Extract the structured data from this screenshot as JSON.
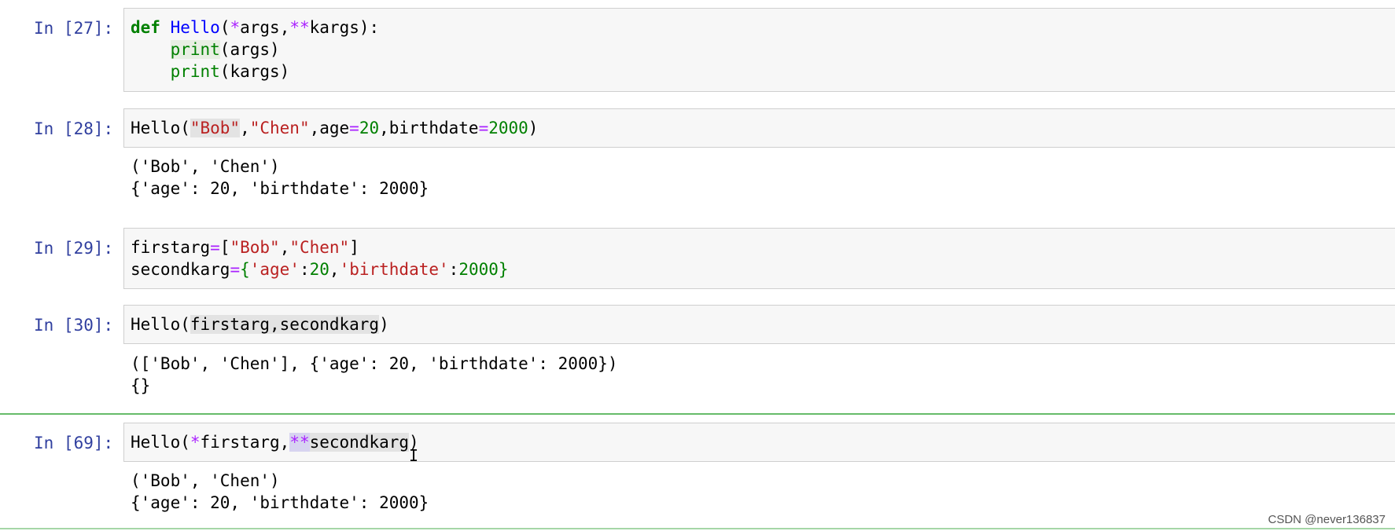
{
  "cells": [
    {
      "prompt": "In [27]:",
      "input_lines": [
        [
          [
            "def",
            "kw"
          ],
          [
            " ",
            ""
          ],
          [
            "Hello",
            "fn"
          ],
          [
            "(",
            ""
          ],
          [
            "*",
            "op"
          ],
          [
            "args,",
            ""
          ],
          [
            "**",
            "op"
          ],
          [
            "kargs):",
            ""
          ]
        ],
        [
          [
            "    ",
            ""
          ],
          [
            "print",
            "num hlg"
          ],
          [
            "(args)",
            ""
          ]
        ],
        [
          [
            "    ",
            ""
          ],
          [
            "print",
            "num"
          ],
          [
            "(kargs)",
            ""
          ]
        ]
      ],
      "output_lines": []
    },
    {
      "prompt": "In [28]:",
      "input_lines": [
        [
          [
            "Hello(",
            ""
          ],
          [
            "\"Bob\"",
            "str hl"
          ],
          [
            ",",
            ""
          ],
          [
            "\"Chen\"",
            "str"
          ],
          [
            ",age",
            ""
          ],
          [
            "=",
            "op"
          ],
          [
            "20",
            "num"
          ],
          [
            ",birthdate",
            ""
          ],
          [
            "=",
            "op"
          ],
          [
            "2000",
            "num"
          ],
          [
            ")",
            ""
          ]
        ]
      ],
      "output_lines": [
        "('Bob', 'Chen')",
        "{'age': 20, 'birthdate': 2000}"
      ]
    },
    {
      "prompt": "In [29]:",
      "input_lines": [
        [
          [
            "firstarg",
            ""
          ],
          [
            "=",
            "op"
          ],
          [
            "[",
            ""
          ],
          [
            "\"Bob\"",
            "str"
          ],
          [
            ",",
            ""
          ],
          [
            "\"Chen\"",
            "str"
          ],
          [
            "]",
            ""
          ]
        ],
        [
          [
            "secondkarg",
            ""
          ],
          [
            "=",
            "op"
          ],
          [
            "{",
            "num"
          ],
          [
            "'age'",
            "str"
          ],
          [
            ":",
            ""
          ],
          [
            "20",
            "num"
          ],
          [
            ",",
            ""
          ],
          [
            "'birthdate'",
            "str"
          ],
          [
            ":",
            ""
          ],
          [
            "2000",
            "num"
          ],
          [
            "}",
            "num"
          ]
        ]
      ],
      "output_lines": []
    },
    {
      "prompt": "In [30]:",
      "input_lines": [
        [
          [
            "Hello(",
            ""
          ],
          [
            "firstarg,secondkarg",
            "hl"
          ],
          [
            ")",
            ""
          ]
        ]
      ],
      "output_lines": [
        "(['Bob', 'Chen'], {'age': 20, 'birthdate': 2000})",
        "{}"
      ]
    },
    {
      "prompt": "In [69]:",
      "input_lines": [
        [
          [
            "Hello(",
            ""
          ],
          [
            "*",
            "op"
          ],
          [
            "firstarg,",
            ""
          ],
          [
            "**",
            "op sel"
          ],
          [
            "secondkarg",
            "hl"
          ],
          [
            ")",
            ""
          ]
        ]
      ],
      "output_lines": [
        "('Bob', 'Chen')",
        "{'age': 20, 'birthdate': 2000}"
      ]
    }
  ],
  "watermark": "CSDN @never136837",
  "colors": {
    "prompt": "#303f9f",
    "keyword": "#008000",
    "function": "#0000ff",
    "operator": "#aa22ff",
    "string": "#ba2121",
    "number": "#008000",
    "cell_background": "#f7f7f7",
    "selected_cell_border": "#66bb6a"
  }
}
